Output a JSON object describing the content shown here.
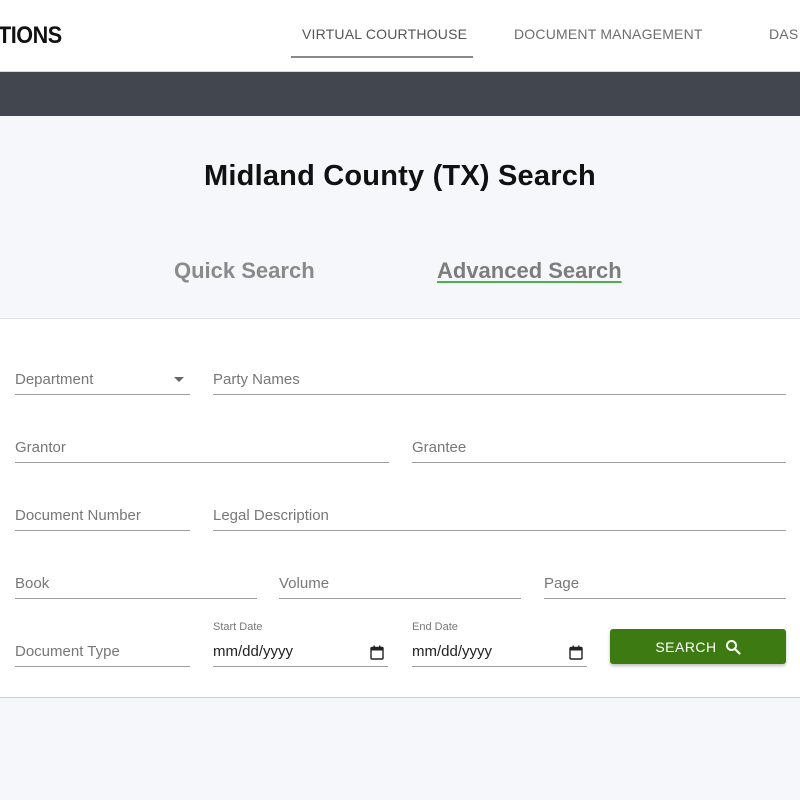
{
  "header": {
    "logo_text": "TIONS",
    "nav": [
      {
        "label": "VIRTUAL COURTHOUSE",
        "active": true
      },
      {
        "label": "DOCUMENT MANAGEMENT",
        "active": false
      },
      {
        "label": "DAS",
        "active": false
      }
    ]
  },
  "page": {
    "title": "Midland County (TX) Search",
    "tabs": [
      {
        "label": "Quick Search",
        "active": false
      },
      {
        "label": "Advanced Search",
        "active": true
      }
    ]
  },
  "form": {
    "department_label": "Department",
    "party_names_label": "Party Names",
    "grantor_label": "Grantor",
    "grantee_label": "Grantee",
    "document_number_label": "Document Number",
    "legal_description_label": "Legal Description",
    "book_label": "Book",
    "volume_label": "Volume",
    "page_label": "Page",
    "document_type_label": "Document Type",
    "start_date": {
      "label": "Start Date",
      "value": "mm/dd/yyyy"
    },
    "end_date": {
      "label": "End Date",
      "value": "mm/dd/yyyy"
    },
    "search_button_label": "SEARCH"
  },
  "icons": {
    "dropdown": "chevron-down-icon",
    "calendar": "calendar-icon",
    "search": "search-icon"
  },
  "colors": {
    "banner": "#41464f",
    "search_button": "#3e7a12",
    "active_tab_underline": "#4caf50"
  }
}
